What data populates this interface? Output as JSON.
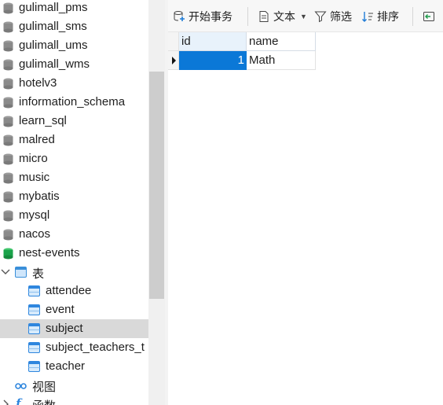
{
  "tree": {
    "databases_before": [
      "gulimall_pms",
      "gulimall_sms",
      "gulimall_ums",
      "gulimall_wms",
      "hotelv3",
      "information_schema",
      "learn_sql",
      "malred",
      "micro",
      "music",
      "mybatis",
      "mysql",
      "nacos"
    ],
    "active_db": "nest-events",
    "tables_group": "表",
    "tables": [
      "attendee",
      "event",
      "subject",
      "subject_teachers_t",
      "teacher"
    ],
    "selected_table": "subject",
    "views_group": "视图",
    "functions_group": "函数"
  },
  "toolbar": {
    "begin_transaction": "开始事务",
    "text": "文本",
    "filter": "筛选",
    "sort": "排序"
  },
  "grid": {
    "columns": [
      "id",
      "name"
    ],
    "rows": [
      {
        "id": "1",
        "name": "Math"
      }
    ]
  },
  "colors": {
    "selection": "#0b78d7",
    "active_db": "#1aa34a",
    "db_gray": "#8a8a8a",
    "table_icon": "#2e86de"
  }
}
